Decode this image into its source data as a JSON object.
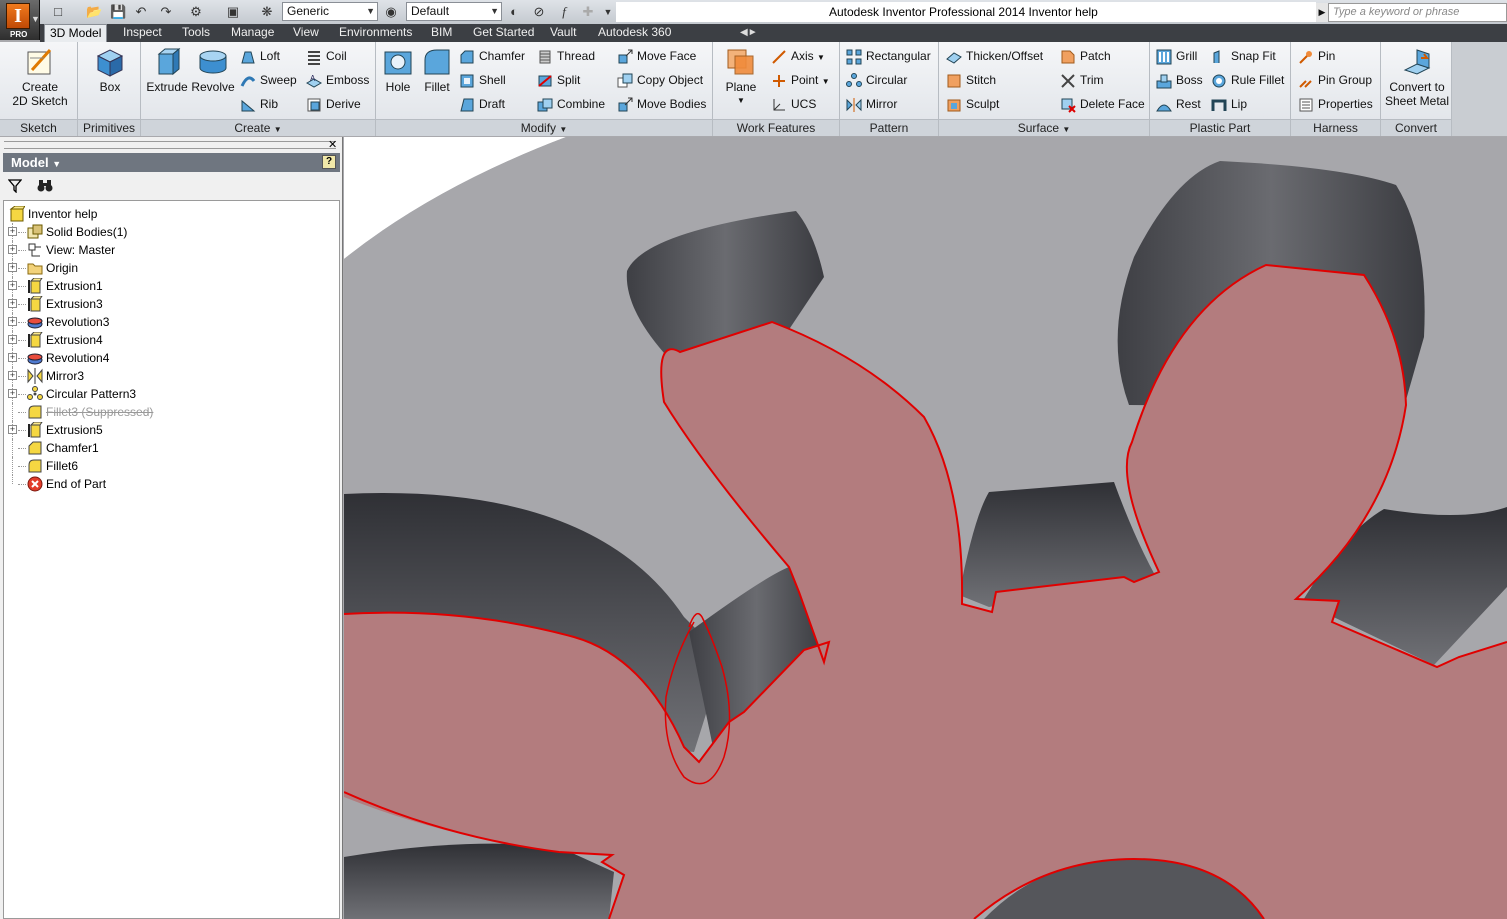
{
  "titlebar": {
    "title": "Autodesk Inventor Professional 2014    Inventor help",
    "search_placeholder": "Type a keyword or phrase",
    "material_combo": "Generic",
    "appearance_combo": "Default",
    "app_badge": "PRO",
    "app_letter": "I"
  },
  "tabs": [
    {
      "label": "3D Model",
      "active": true
    },
    {
      "label": "Inspect"
    },
    {
      "label": "Tools"
    },
    {
      "label": "Manage"
    },
    {
      "label": "View"
    },
    {
      "label": "Environments"
    },
    {
      "label": "BIM"
    },
    {
      "label": "Get Started"
    },
    {
      "label": "Vault"
    },
    {
      "label": "Autodesk 360"
    }
  ],
  "ribbon": {
    "sketch": {
      "label": "Sketch",
      "create": "Create\n2D Sketch"
    },
    "primitives": {
      "label": "Primitives",
      "box": "Box"
    },
    "create": {
      "label": "Create",
      "extrude": "Extrude",
      "revolve": "Revolve",
      "loft": "Loft",
      "sweep": "Sweep",
      "rib": "Rib",
      "coil": "Coil",
      "emboss": "Emboss",
      "derive": "Derive"
    },
    "modify": {
      "label": "Modify",
      "hole": "Hole",
      "fillet": "Fillet",
      "chamfer": "Chamfer",
      "shell": "Shell",
      "draft": "Draft",
      "thread": "Thread",
      "split": "Split",
      "combine": "Combine",
      "move_face": "Move Face",
      "copy_object": "Copy Object",
      "move_bodies": "Move Bodies"
    },
    "work_features": {
      "label": "Work Features",
      "plane": "Plane",
      "axis": "Axis",
      "point": "Point",
      "ucs": "UCS"
    },
    "pattern": {
      "label": "Pattern",
      "rectangular": "Rectangular",
      "circular": "Circular",
      "mirror": "Mirror"
    },
    "surface": {
      "label": "Surface",
      "thicken": "Thicken/Offset",
      "stitch": "Stitch",
      "sculpt": "Sculpt",
      "patch": "Patch",
      "trim": "Trim",
      "delete_face": "Delete Face"
    },
    "plastic_part": {
      "label": "Plastic Part",
      "grill": "Grill",
      "boss": "Boss",
      "rest": "Rest",
      "snap_fit": "Snap Fit",
      "rule_fillet": "Rule Fillet",
      "lip": "Lip"
    },
    "harness": {
      "label": "Harness",
      "pin": "Pin",
      "pin_group": "Pin Group",
      "properties": "Properties"
    },
    "convert": {
      "label": "Convert",
      "sheet_metal": "Convert to\nSheet Metal"
    }
  },
  "browser": {
    "header": "Model",
    "tree": [
      {
        "label": "Inventor help",
        "icon": "part-icon",
        "root": true
      },
      {
        "label": "Solid Bodies(1)",
        "icon": "solid-bodies-icon",
        "expandable": true
      },
      {
        "label": "View: Master",
        "icon": "view-icon",
        "expandable": true
      },
      {
        "label": "Origin",
        "icon": "folder-icon",
        "expandable": true
      },
      {
        "label": "Extrusion1",
        "icon": "extrusion-icon",
        "expandable": true
      },
      {
        "label": "Extrusion3",
        "icon": "extrusion-icon",
        "expandable": true
      },
      {
        "label": "Revolution3",
        "icon": "revolution-icon",
        "expandable": true
      },
      {
        "label": "Extrusion4",
        "icon": "extrusion-icon",
        "expandable": true
      },
      {
        "label": "Revolution4",
        "icon": "revolution-icon",
        "expandable": true
      },
      {
        "label": "Mirror3",
        "icon": "mirror-icon",
        "expandable": true
      },
      {
        "label": "Circular Pattern3",
        "icon": "circular-pattern-icon",
        "expandable": true
      },
      {
        "label": "Fillet3 (Suppressed)",
        "icon": "fillet-icon",
        "suppressed": true
      },
      {
        "label": "Extrusion5",
        "icon": "extrusion-icon",
        "expandable": true
      },
      {
        "label": "Chamfer1",
        "icon": "chamfer-icon"
      },
      {
        "label": "Fillet6",
        "icon": "fillet-icon"
      },
      {
        "label": "End of Part",
        "icon": "end-of-part-icon"
      }
    ]
  },
  "colors": {
    "tab_bar": "#3c3f44",
    "viewport_bg": "#a7a7ab",
    "gear_face": "#b37c7e",
    "gear_outline": "#e00000",
    "gear_wall": "#4a4b50"
  }
}
